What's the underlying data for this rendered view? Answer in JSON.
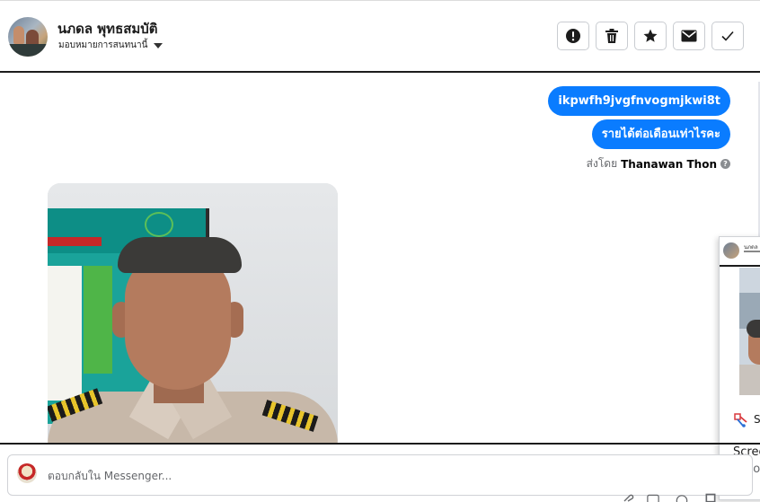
{
  "header": {
    "contact_name": "นภดล พุทธสมบัติ",
    "assign_label": "มอบหมายการสนทนานี้",
    "actions": [
      {
        "name": "mark-spam",
        "icon": "exclamation-icon"
      },
      {
        "name": "delete",
        "icon": "trash-icon"
      },
      {
        "name": "star",
        "icon": "star-icon"
      },
      {
        "name": "mark-unread",
        "icon": "envelope-icon"
      },
      {
        "name": "mark-done",
        "icon": "check-icon"
      }
    ]
  },
  "messages": [
    {
      "direction": "outgoing",
      "text": "ikpwfh9jvgfnvogmjkwi8t"
    },
    {
      "direction": "outgoing",
      "text": "รายได้ต่อเดือนเท่าไรคะ"
    }
  ],
  "sent_by": {
    "prefix": "ส่งโดย",
    "name": "Thanawan Thon"
  },
  "incoming_photo": {
    "alt": "photo-attachment"
  },
  "floating_panel": {
    "title_fragment": "นภดล",
    "s_label": "S",
    "screen_label": "Scree",
    "auto_label": "Auto"
  },
  "composer": {
    "placeholder": "ตอบกลับใน Messenger..."
  },
  "colors": {
    "accent_blue": "#0a7cff",
    "border": "#c9ccd1",
    "divider": "#1c1c1c"
  }
}
